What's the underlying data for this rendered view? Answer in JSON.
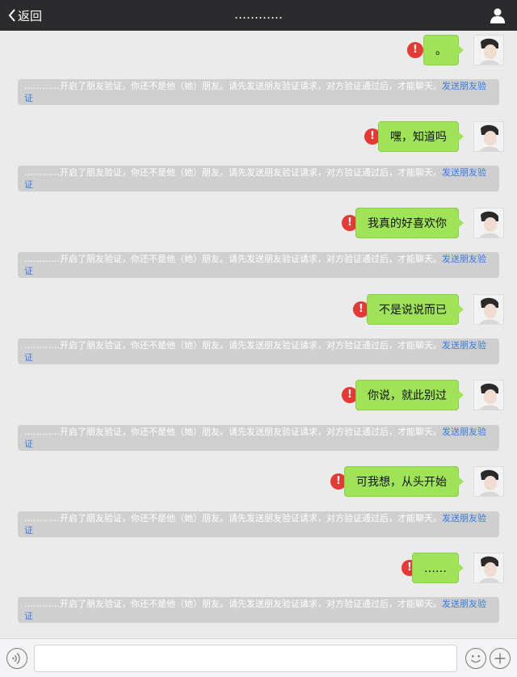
{
  "header": {
    "back_label": "返回",
    "title": "…………"
  },
  "messages": [
    {
      "text": "。"
    },
    {
      "text": "嘿，知道吗"
    },
    {
      "text": "我真的好喜欢你"
    },
    {
      "text": "不是说说而已"
    },
    {
      "text": "你说，就此别过"
    },
    {
      "text": "可我想，从头开始"
    },
    {
      "text": "……"
    }
  ],
  "system_notice": {
    "text": "…………开启了朋友验证，你还不是他（她）朋友。请先发送朋友验证请求，对方验证通过后，才能聊天。",
    "link": "发送朋友验证"
  },
  "error_icon": {
    "glyph": "!",
    "color": "#e53935"
  },
  "colors": {
    "topbar": "#2b2b2d",
    "bubble": "#9fe458",
    "background": "#ebebeb",
    "link": "#3a7be0"
  },
  "icons": {
    "back": "chevron-left-icon",
    "profile": "person-icon",
    "voice": "voice-icon",
    "emoji": "emoji-icon",
    "plus": "plus-icon"
  }
}
